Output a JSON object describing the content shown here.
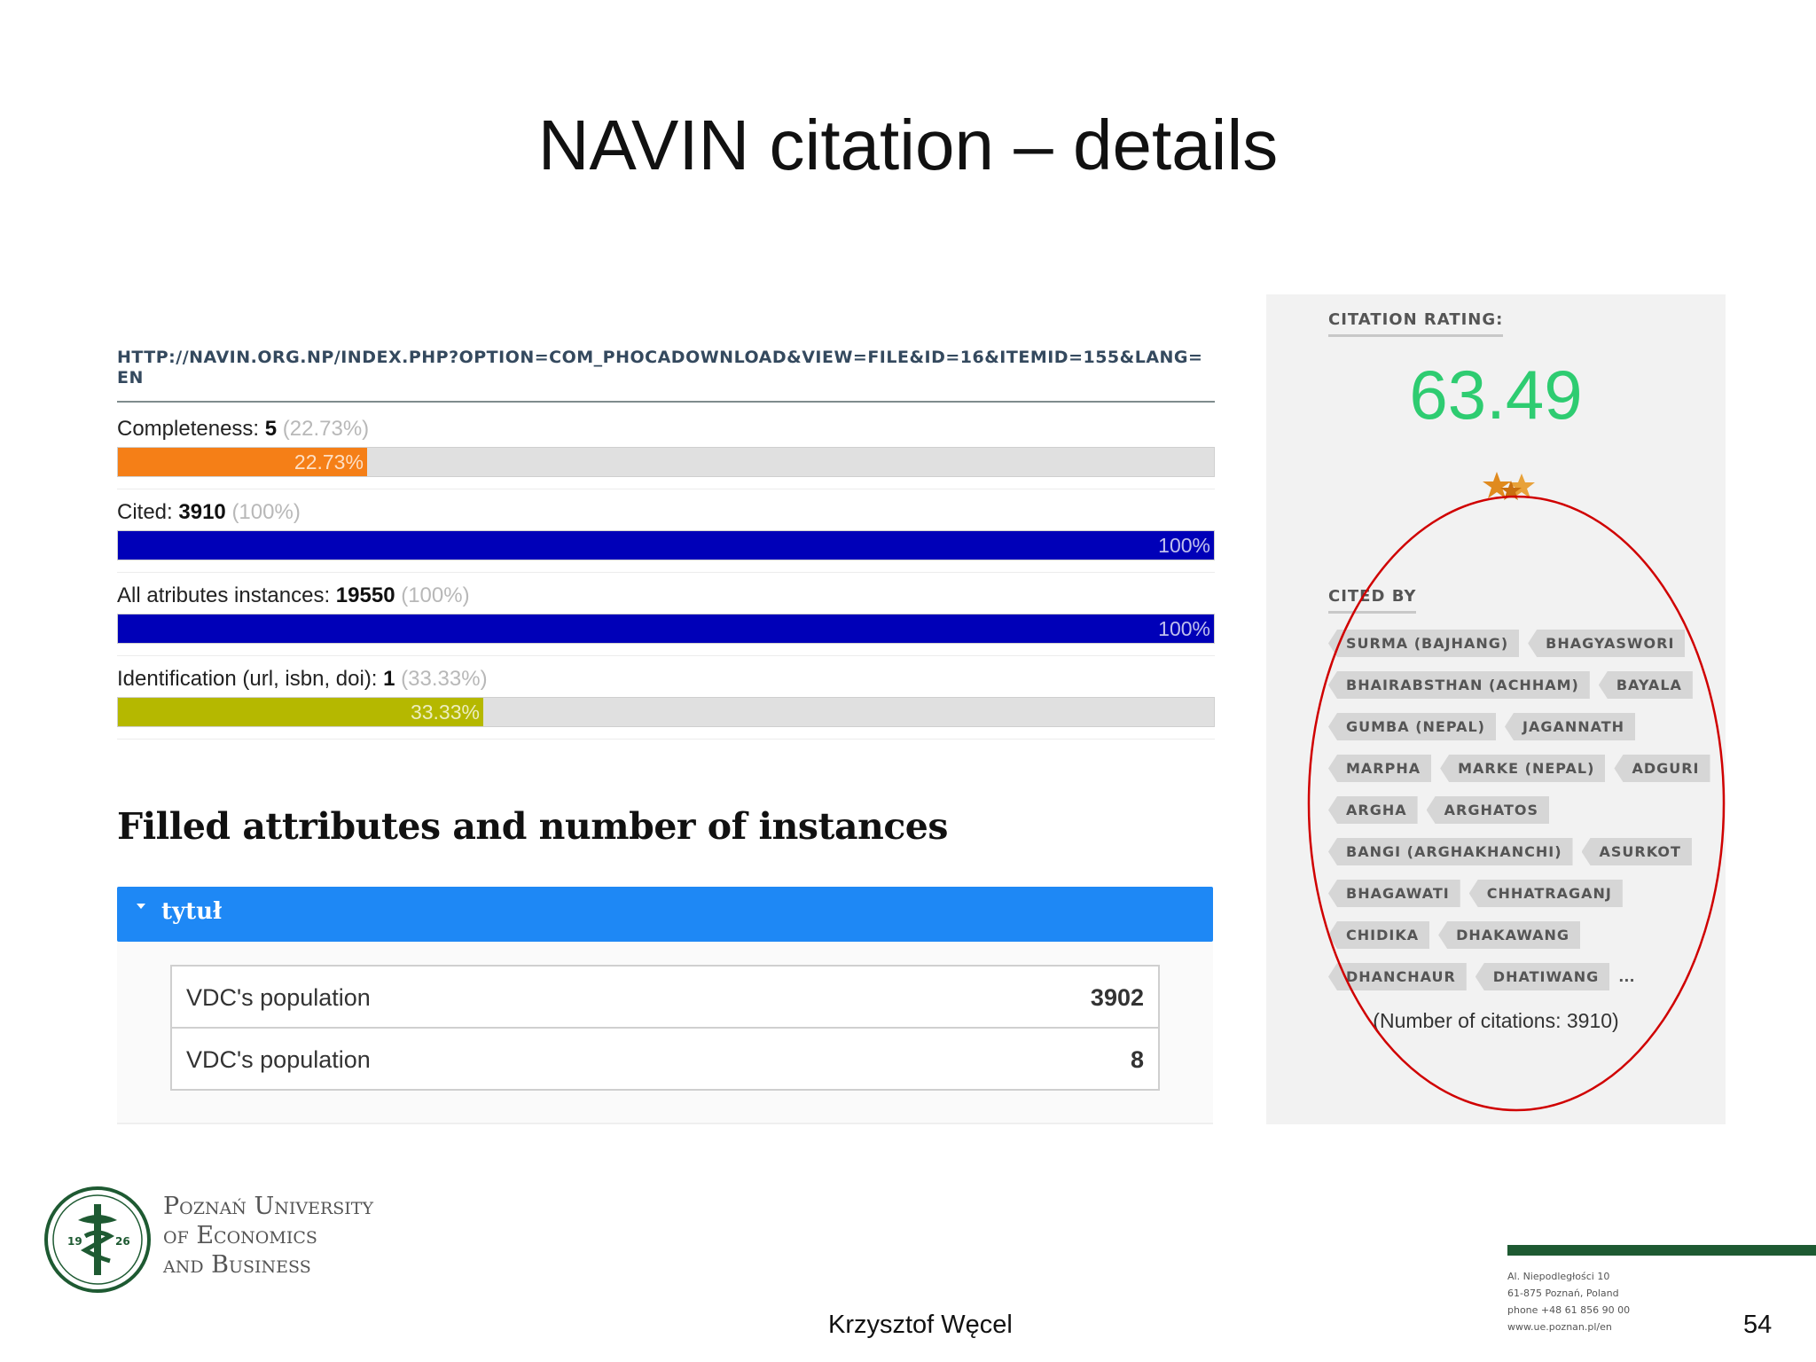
{
  "slide": {
    "title": "NAVIN citation – details",
    "author": "Krzysztof Węcel",
    "page_number": "54"
  },
  "record": {
    "url": "HTTP://NAVIN.ORG.NP/INDEX.PHP?OPTION=COM_PHOCADOWNLOAD&VIEW=FILE&ID=16&ITEMID=155&LANG=EN",
    "metrics": [
      {
        "label": "Completeness: ",
        "value": "5",
        "pct": "(22.73%)",
        "bar_text": "22.73%",
        "fraction": 0.2273,
        "color": "#f57f17"
      },
      {
        "label": "Cited: ",
        "value": "3910",
        "pct": "(100%)",
        "bar_text": "100%",
        "fraction": 1.0,
        "color": "#0000b8"
      },
      {
        "label": "All atributes instances: ",
        "value": "19550",
        "pct": "(100%)",
        "bar_text": "100%",
        "fraction": 1.0,
        "color": "#0000b8"
      },
      {
        "label": "Identification (url, isbn, doi): ",
        "value": "1",
        "pct": "(33.33%)",
        "bar_text": "33.33%",
        "fraction": 0.3333,
        "color": "#b5b800"
      }
    ],
    "section_heading": "Filled attributes and number of instances",
    "accordion": {
      "title": "tytuł",
      "rows": [
        {
          "name": "VDC's population",
          "count": "3902"
        },
        {
          "name": "VDC's population",
          "count": "8"
        }
      ]
    }
  },
  "rating_panel": {
    "rating_label": "CITATION RATING:",
    "rating_value": "63.49",
    "stars_icon": "stars-icon",
    "cited_by_label": "CITED BY",
    "cited_by_rows": [
      [
        "SURMA (BAJHANG)",
        "BHAGYASWORI"
      ],
      [
        "BHAIRABSTHAN (ACHHAM)",
        "BAYALA"
      ],
      [
        "GUMBA (NEPAL)",
        "JAGANNATH"
      ],
      [
        "MARPHA",
        "MARKE (NEPAL)",
        "ADGURI"
      ],
      [
        "ARGHA",
        "ARGHATOS"
      ],
      [
        "BANGI (ARGHAKHANCHI)",
        "ASURKOT"
      ],
      [
        "BHAGAWATI",
        "CHHATRAGANJ"
      ],
      [
        "CHIDIKA",
        "DHAKAWANG"
      ],
      [
        "DHANCHAUR",
        "DHATIWANG"
      ]
    ],
    "ellipsis": "...",
    "citations_count_text": "(Number of citations: 3910)"
  },
  "footer": {
    "university_lines": [
      "Poznań University",
      "of Economics",
      "and Business"
    ],
    "logo_year_left": "19",
    "logo_year_right": "26",
    "address_lines": [
      "Al. Niepodległości 10",
      "61-875 Poznań, Poland",
      "phone +48 61 856 90 00",
      "www.ue.poznan.pl/en"
    ]
  },
  "colors": {
    "rating_green": "#2ecc71",
    "accordion_blue": "#1e88f5",
    "annotation_red": "#d00000",
    "footer_green": "#1e5a32"
  }
}
